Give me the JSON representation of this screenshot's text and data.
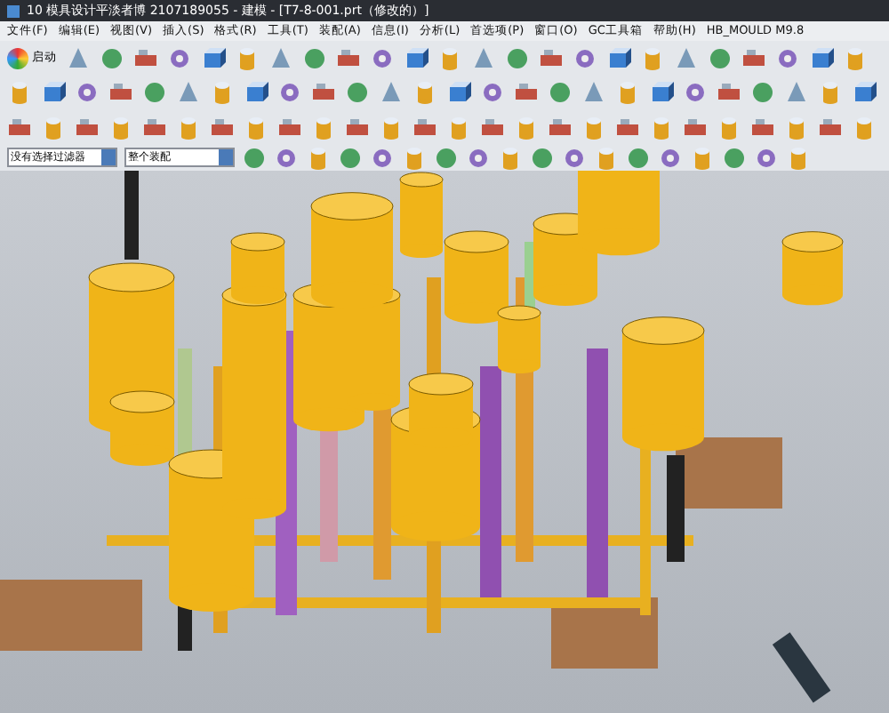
{
  "window": {
    "title": "10  模具设计平淡者博 2107189055 - 建模 - [T7-8-001.prt（修改的）]"
  },
  "menu": [
    "文件(F)",
    "编辑(E)",
    "视图(V)",
    "插入(S)",
    "格式(R)",
    "工具(T)",
    "装配(A)",
    "信息(I)",
    "分析(L)",
    "首选项(P)",
    "窗口(O)",
    "GC工具箱",
    "帮助(H)",
    "HB_MOULD M9.8"
  ],
  "toolbar": {
    "start_label": "启动"
  },
  "filters": [
    {
      "value": "没有选择过滤器"
    },
    {
      "value": "整个装配"
    }
  ]
}
